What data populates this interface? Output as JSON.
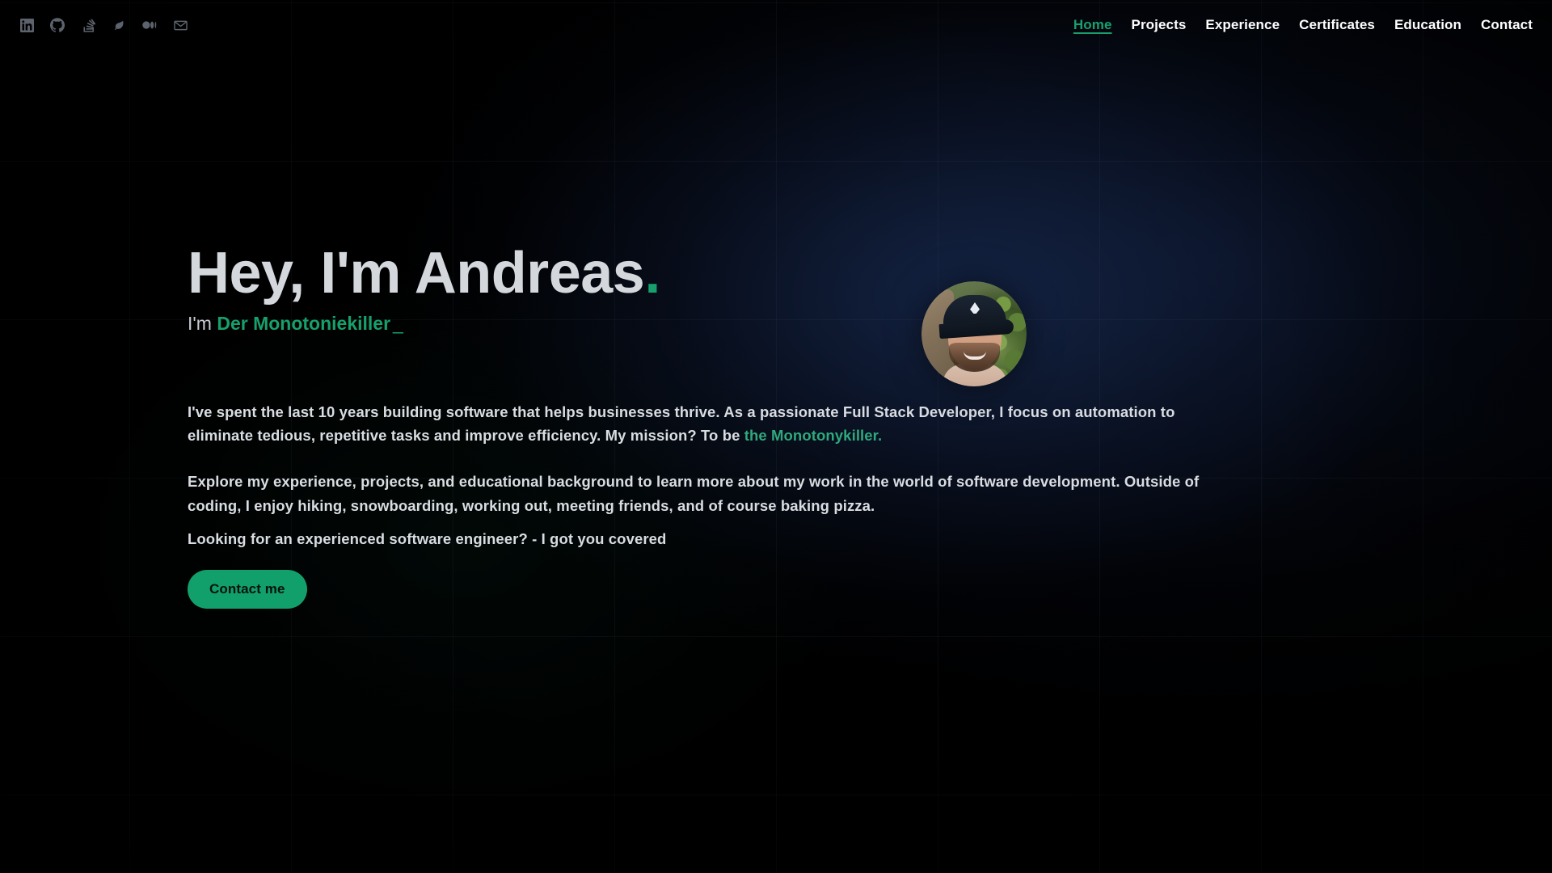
{
  "header": {
    "socials": [
      {
        "name": "linkedin-icon",
        "label": "LinkedIn"
      },
      {
        "name": "github-icon",
        "label": "GitHub"
      },
      {
        "name": "stackoverflow-icon",
        "label": "Stack Overflow"
      },
      {
        "name": "leaf-icon",
        "label": "Dev.to"
      },
      {
        "name": "medium-icon",
        "label": "Medium"
      },
      {
        "name": "mail-icon",
        "label": "Email"
      }
    ],
    "nav": [
      {
        "label": "Home",
        "active": true
      },
      {
        "label": "Projects",
        "active": false
      },
      {
        "label": "Experience",
        "active": false
      },
      {
        "label": "Certificates",
        "active": false
      },
      {
        "label": "Education",
        "active": false
      },
      {
        "label": "Contact",
        "active": false
      }
    ]
  },
  "hero": {
    "title": "Hey, I'm Andreas",
    "title_dot": ".",
    "sub_prefix": "I'm ",
    "sub_highlight": "Der Monotoniekiller",
    "sub_caret": "_",
    "avatar_alt": "Profile photo of Andreas wearing a dark cap"
  },
  "body": {
    "p1_a": "I've spent the last 10 years building software that helps businesses thrive. As a passionate Full Stack Developer, I focus on automation to eliminate tedious, repetitive tasks and improve efficiency. My mission? To be ",
    "p1_green": "the Monotonykiller.",
    "p2": "Explore my experience, projects, and educational background to learn more about my work in the world of software development. Outside of coding, I enjoy hiking, snowboarding, working out, meeting friends, and of course baking pizza.",
    "p3": "Looking for an experienced software engineer? - I got you covered"
  },
  "cta": {
    "label": "Contact me"
  },
  "colors": {
    "background": "#000000",
    "accent_green": "#17a06c",
    "button_green": "#11a06c",
    "text_primary": "#d9dde2",
    "heading": "#d4d8dd",
    "social_icon": "#5d636d",
    "nav_text": "#ffffff"
  }
}
